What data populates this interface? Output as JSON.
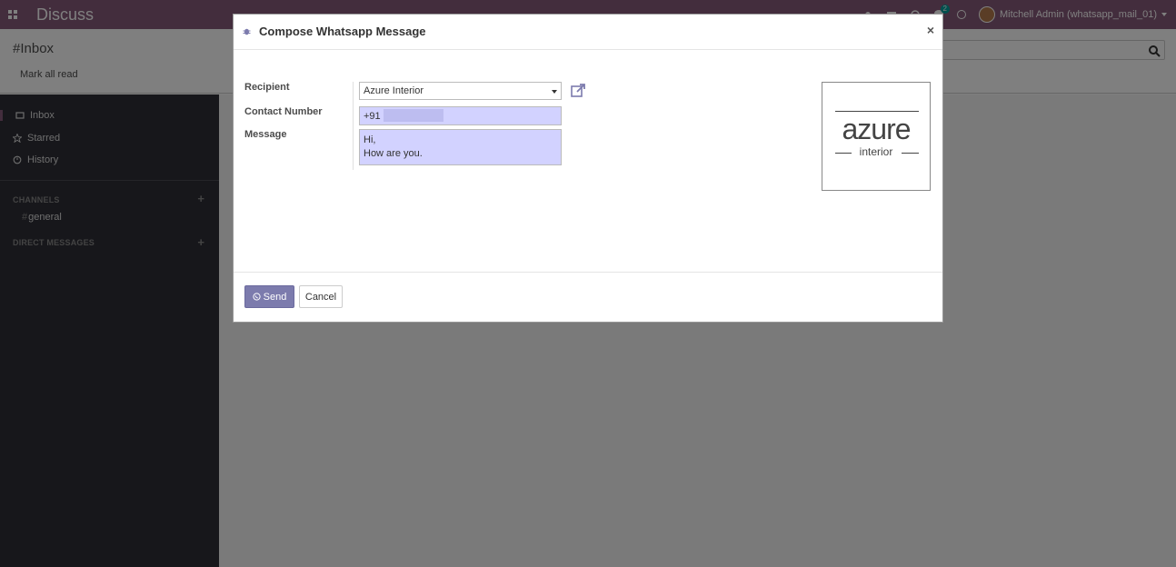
{
  "navbar": {
    "app_title": "Discuss",
    "chat_badge_count": "2",
    "user_name": "Mitchell Admin (whatsapp_mail_01)",
    "brand_color": "#875a7b"
  },
  "control_panel": {
    "title": "#Inbox",
    "mark_all_read": "Mark all read"
  },
  "sidebar": {
    "items": [
      {
        "label": "Inbox",
        "icon": "inbox-icon"
      },
      {
        "label": "Starred",
        "icon": "star-icon"
      },
      {
        "label": "History",
        "icon": "history-icon"
      }
    ],
    "channels_header": "CHANNELS",
    "channels": [
      {
        "label": "general",
        "prefix": "#"
      }
    ],
    "direct_messages_header": "DIRECT MESSAGES"
  },
  "modal": {
    "title": "Compose Whatsapp Message",
    "close_label": "×",
    "fields": {
      "recipient_label": "Recipient",
      "recipient_value": "Azure Interior",
      "contact_label": "Contact Number",
      "contact_prefix": "+91",
      "message_label": "Message",
      "message_value": "Hi,\nHow are you."
    },
    "logo": {
      "main_text": "azure",
      "sub_text": "interior"
    },
    "buttons": {
      "send_label": "Send",
      "cancel_label": "Cancel"
    },
    "accent_color": "#7c7bad"
  }
}
